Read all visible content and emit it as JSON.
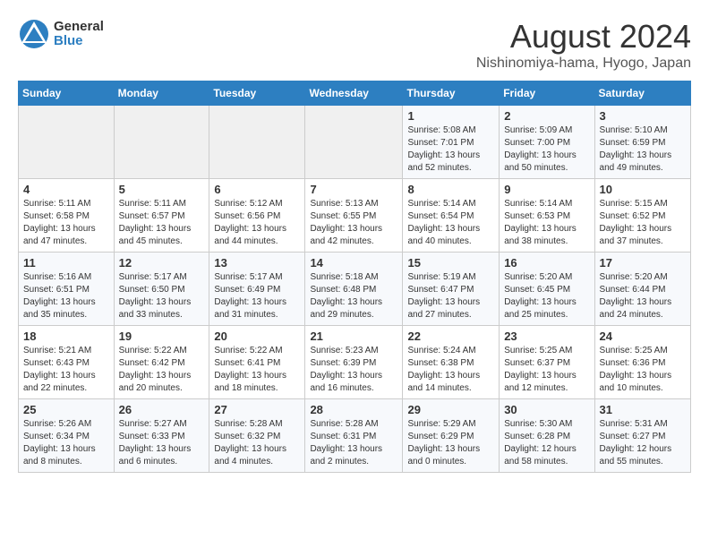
{
  "header": {
    "logo_general": "General",
    "logo_blue": "Blue",
    "month_year": "August 2024",
    "location": "Nishinomiya-hama, Hyogo, Japan"
  },
  "weekdays": [
    "Sunday",
    "Monday",
    "Tuesday",
    "Wednesday",
    "Thursday",
    "Friday",
    "Saturday"
  ],
  "weeks": [
    [
      {
        "day": "",
        "info": ""
      },
      {
        "day": "",
        "info": ""
      },
      {
        "day": "",
        "info": ""
      },
      {
        "day": "",
        "info": ""
      },
      {
        "day": "1",
        "info": "Sunrise: 5:08 AM\nSunset: 7:01 PM\nDaylight: 13 hours\nand 52 minutes."
      },
      {
        "day": "2",
        "info": "Sunrise: 5:09 AM\nSunset: 7:00 PM\nDaylight: 13 hours\nand 50 minutes."
      },
      {
        "day": "3",
        "info": "Sunrise: 5:10 AM\nSunset: 6:59 PM\nDaylight: 13 hours\nand 49 minutes."
      }
    ],
    [
      {
        "day": "4",
        "info": "Sunrise: 5:11 AM\nSunset: 6:58 PM\nDaylight: 13 hours\nand 47 minutes."
      },
      {
        "day": "5",
        "info": "Sunrise: 5:11 AM\nSunset: 6:57 PM\nDaylight: 13 hours\nand 45 minutes."
      },
      {
        "day": "6",
        "info": "Sunrise: 5:12 AM\nSunset: 6:56 PM\nDaylight: 13 hours\nand 44 minutes."
      },
      {
        "day": "7",
        "info": "Sunrise: 5:13 AM\nSunset: 6:55 PM\nDaylight: 13 hours\nand 42 minutes."
      },
      {
        "day": "8",
        "info": "Sunrise: 5:14 AM\nSunset: 6:54 PM\nDaylight: 13 hours\nand 40 minutes."
      },
      {
        "day": "9",
        "info": "Sunrise: 5:14 AM\nSunset: 6:53 PM\nDaylight: 13 hours\nand 38 minutes."
      },
      {
        "day": "10",
        "info": "Sunrise: 5:15 AM\nSunset: 6:52 PM\nDaylight: 13 hours\nand 37 minutes."
      }
    ],
    [
      {
        "day": "11",
        "info": "Sunrise: 5:16 AM\nSunset: 6:51 PM\nDaylight: 13 hours\nand 35 minutes."
      },
      {
        "day": "12",
        "info": "Sunrise: 5:17 AM\nSunset: 6:50 PM\nDaylight: 13 hours\nand 33 minutes."
      },
      {
        "day": "13",
        "info": "Sunrise: 5:17 AM\nSunset: 6:49 PM\nDaylight: 13 hours\nand 31 minutes."
      },
      {
        "day": "14",
        "info": "Sunrise: 5:18 AM\nSunset: 6:48 PM\nDaylight: 13 hours\nand 29 minutes."
      },
      {
        "day": "15",
        "info": "Sunrise: 5:19 AM\nSunset: 6:47 PM\nDaylight: 13 hours\nand 27 minutes."
      },
      {
        "day": "16",
        "info": "Sunrise: 5:20 AM\nSunset: 6:45 PM\nDaylight: 13 hours\nand 25 minutes."
      },
      {
        "day": "17",
        "info": "Sunrise: 5:20 AM\nSunset: 6:44 PM\nDaylight: 13 hours\nand 24 minutes."
      }
    ],
    [
      {
        "day": "18",
        "info": "Sunrise: 5:21 AM\nSunset: 6:43 PM\nDaylight: 13 hours\nand 22 minutes."
      },
      {
        "day": "19",
        "info": "Sunrise: 5:22 AM\nSunset: 6:42 PM\nDaylight: 13 hours\nand 20 minutes."
      },
      {
        "day": "20",
        "info": "Sunrise: 5:22 AM\nSunset: 6:41 PM\nDaylight: 13 hours\nand 18 minutes."
      },
      {
        "day": "21",
        "info": "Sunrise: 5:23 AM\nSunset: 6:39 PM\nDaylight: 13 hours\nand 16 minutes."
      },
      {
        "day": "22",
        "info": "Sunrise: 5:24 AM\nSunset: 6:38 PM\nDaylight: 13 hours\nand 14 minutes."
      },
      {
        "day": "23",
        "info": "Sunrise: 5:25 AM\nSunset: 6:37 PM\nDaylight: 13 hours\nand 12 minutes."
      },
      {
        "day": "24",
        "info": "Sunrise: 5:25 AM\nSunset: 6:36 PM\nDaylight: 13 hours\nand 10 minutes."
      }
    ],
    [
      {
        "day": "25",
        "info": "Sunrise: 5:26 AM\nSunset: 6:34 PM\nDaylight: 13 hours\nand 8 minutes."
      },
      {
        "day": "26",
        "info": "Sunrise: 5:27 AM\nSunset: 6:33 PM\nDaylight: 13 hours\nand 6 minutes."
      },
      {
        "day": "27",
        "info": "Sunrise: 5:28 AM\nSunset: 6:32 PM\nDaylight: 13 hours\nand 4 minutes."
      },
      {
        "day": "28",
        "info": "Sunrise: 5:28 AM\nSunset: 6:31 PM\nDaylight: 13 hours\nand 2 minutes."
      },
      {
        "day": "29",
        "info": "Sunrise: 5:29 AM\nSunset: 6:29 PM\nDaylight: 13 hours\nand 0 minutes."
      },
      {
        "day": "30",
        "info": "Sunrise: 5:30 AM\nSunset: 6:28 PM\nDaylight: 12 hours\nand 58 minutes."
      },
      {
        "day": "31",
        "info": "Sunrise: 5:31 AM\nSunset: 6:27 PM\nDaylight: 12 hours\nand 55 minutes."
      }
    ]
  ]
}
